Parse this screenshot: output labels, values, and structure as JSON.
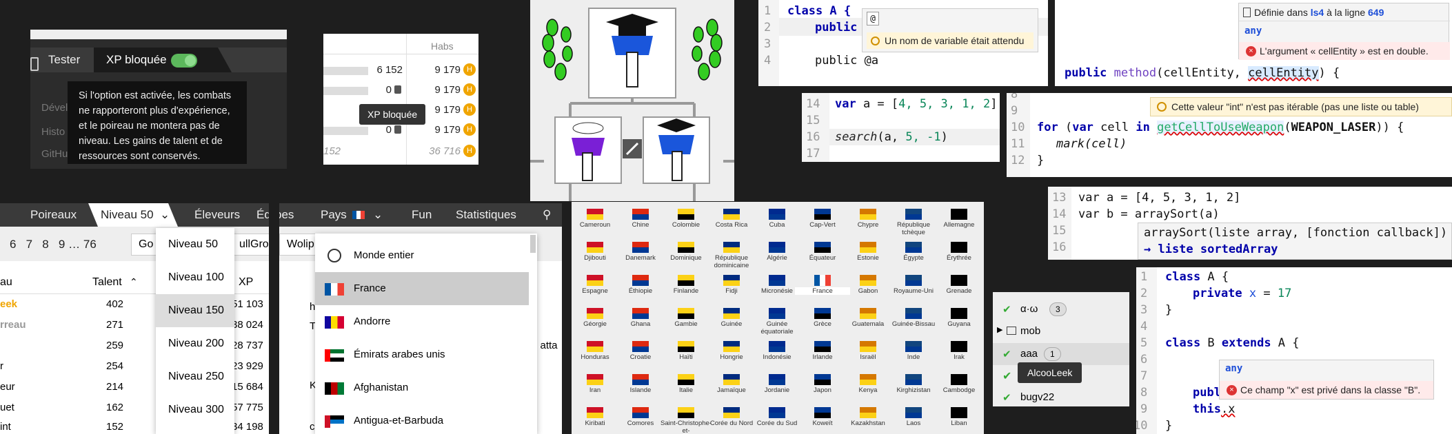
{
  "colors": {
    "accent_green": "#5cb85c",
    "dark": "#1e1e1e",
    "gold": "#f0a500",
    "error": "#d00"
  },
  "p1": {
    "tester": "Tester",
    "xp_blocked": "XP bloquée",
    "side1": "Dével",
    "side2": "Histo",
    "side3": "GitHu",
    "tooltip": "Si l'option est activée, les combats ne rapporteront plus d'expérience, et le poireau ne montera pas de niveau. Les gains de talent et de ressources sont conservés."
  },
  "p2": {
    "header": "Habs",
    "rows": [
      {
        "left": "6 152",
        "right": "9 179"
      },
      {
        "left": "0",
        "right": "9 179"
      },
      {
        "left": "",
        "right": "9 179"
      },
      {
        "left": "0",
        "right": "9 179"
      }
    ],
    "footer_left": "152",
    "footer_right": "36 716",
    "tooltip": "XP bloquée"
  },
  "p4": {
    "lines": [
      "1",
      "2",
      "3",
      "4"
    ],
    "code1": "class A {",
    "code2": "public",
    "code4": "public @a",
    "popup_at": "@",
    "popup_err": "Un nom de variable était attendu"
  },
  "p5": {
    "defined": "Définie dans ",
    "file": "ls4",
    "line_text": " à la ligne ",
    "line_no": "649",
    "any": "any",
    "error": "L'argument « cellEntity » est en double.",
    "code_public": "public",
    "code_method": "method",
    "code_args": "(cellEntity, ",
    "code_dup": "cellEntity",
    "code_end": ") {"
  },
  "p6": {
    "l14": "14",
    "l15": "15",
    "l16": "16",
    "l17": "17",
    "c14a": "var",
    "c14b": " a = [",
    "c14c": "4, 5, 3, 1, 2",
    "c14d": "]",
    "c16a": "search",
    "c16b": "(a, ",
    "c16c": "5, -1",
    "c16d": ")"
  },
  "p7": {
    "l8": "8",
    "l9": "9",
    "l10": "10",
    "l11": "11",
    "l12": "12",
    "warn": "Cette valeur \"int\" n'est pas itérable (pas une liste ou table)",
    "c10a": "for",
    "c10b": " (",
    "c10c": "var",
    "c10d": " cell ",
    "c10e": "in",
    "c10f": " ",
    "c10g": "getCellToUseWeapon",
    "c10h": "(",
    "c10i": "WEAPON_LASER",
    "c10j": ")) {",
    "c11": "mark(cell)",
    "c12": "}"
  },
  "p8": {
    "l13": "13",
    "l14": "14",
    "l15": "15",
    "l16": "16",
    "c13": "var a = [4, 5, 3, 1, 2]",
    "c14": "var b = arraySort(a)",
    "sig1": "arraySort(liste array, [fonction callback])",
    "sig2": "→ liste sortedArray"
  },
  "p9": {
    "nav": [
      "Poireaux",
      "Niveau 50",
      "Éleveurs",
      "Éq"
    ],
    "pages": [
      "6",
      "7",
      "8",
      "9",
      "…",
      "76"
    ],
    "col_talent": "Talent",
    "col_xp": "XP",
    "rows": [
      {
        "name": "eek",
        "talent": "402",
        "xp": "51 103"
      },
      {
        "name": "rreau",
        "talent": "271",
        "xp": "38 024"
      },
      {
        "name": "",
        "talent": "259",
        "xp": "28 737"
      },
      {
        "name": "r",
        "talent": "254",
        "xp": "23 929"
      },
      {
        "name": "eur",
        "talent": "214",
        "xp": "15 684"
      },
      {
        "name": "uet",
        "talent": "162",
        "xp": "57 775"
      },
      {
        "name": "int",
        "talent": "152",
        "xp": "34 198"
      }
    ],
    "col_name": "au",
    "btn_go": "Go",
    "btn_ull": "ullGrog",
    "dropdown": [
      "Niveau 50",
      "Niveau 100",
      "Niveau 150",
      "Niveau 200",
      "Niveau 250",
      "Niveau 300"
    ]
  },
  "p10": {
    "nav": [
      "pes",
      "Pays",
      "Fun",
      "Statistiques"
    ],
    "btn": "Wolip",
    "items": [
      "Monde entier",
      "France",
      "Andorre",
      "Émirats arabes unis",
      "Afghanistan",
      "Antigua-et-Barbuda"
    ],
    "side": [
      "h",
      "T",
      "",
      "",
      "K",
      "",
      "",
      "c"
    ],
    "attack": "e atta"
  },
  "p11": {
    "countries": [
      "Cameroun",
      "Chine",
      "Colombie",
      "Costa Rica",
      "Cuba",
      "Cap-Vert",
      "Chypre",
      "République tchèque",
      "Allemagne",
      "Djibouti",
      "Danemark",
      "Dominique",
      "République dominicaine",
      "Algérie",
      "Équateur",
      "Estonie",
      "Égypte",
      "Érythrée",
      "Espagne",
      "Éthiopie",
      "Finlande",
      "Fidji",
      "Micronésie",
      "France",
      "Gabon",
      "Royaume-Uni",
      "Grenade",
      "Géorgie",
      "Ghana",
      "Gambie",
      "Guinée",
      "Guinée équatoriale",
      "Grèce",
      "Guatemala",
      "Guinée-Bissau",
      "Guyana",
      "Honduras",
      "Croatie",
      "Haïti",
      "Hongrie",
      "Indonésie",
      "Irlande",
      "Israël",
      "Inde",
      "Irak",
      "Iran",
      "Islande",
      "Italie",
      "Jamaïque",
      "Jordanie",
      "Japon",
      "Kenya",
      "Kirghizistan",
      "Cambodge",
      "Kiribati",
      "Comores",
      "Saint-Christophe-et-",
      "Corée du Nord",
      "Corée du Sud",
      "Koweït",
      "Kazakhstan",
      "Laos",
      "Liban"
    ]
  },
  "p12": {
    "items": [
      {
        "label": "α·ω",
        "count": "3"
      },
      {
        "label": "mob",
        "count": ""
      },
      {
        "label": "aaa",
        "count": "1"
      },
      {
        "label": "",
        "count": ""
      },
      {
        "label": "bugv22",
        "count": ""
      }
    ],
    "tooltip": "AlcooLeek"
  },
  "p13": {
    "lines": [
      "1",
      "2",
      "3",
      "4",
      "5",
      "6",
      "7",
      "8",
      "9",
      "10"
    ],
    "c1a": "class",
    "c1b": " A {",
    "c2a": "private",
    "c2b": " x",
    "c2c": " = ",
    "c2d": "17",
    "c3": "}",
    "c5a": "class",
    "c5b": " B ",
    "c5c": "extends",
    "c5d": " A {",
    "c8": "publ",
    "c9a": "this",
    "c9b": ".x",
    "c10": "}",
    "any": "any",
    "error": "Ce champ \"x\" est privé dans la classe \"B\"."
  }
}
